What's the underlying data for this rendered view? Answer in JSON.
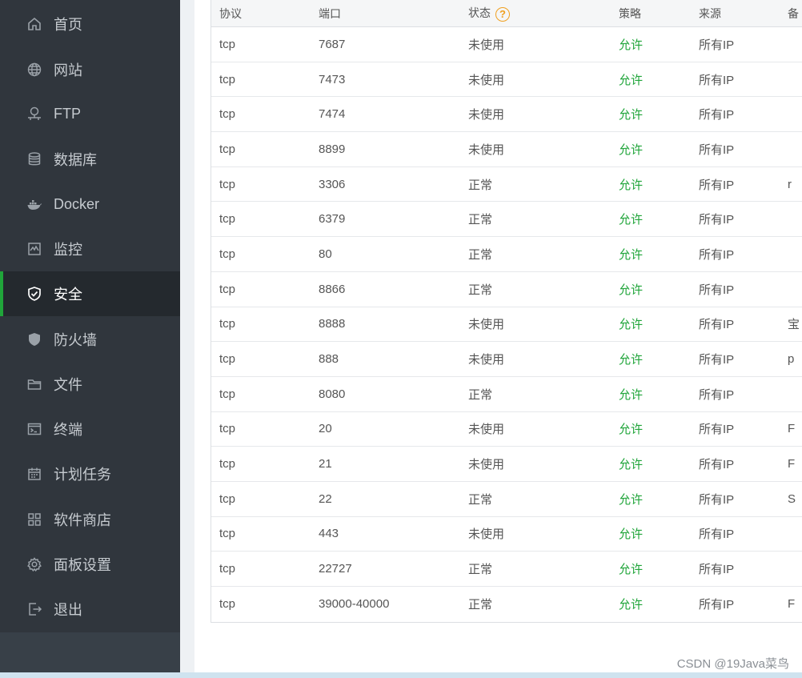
{
  "sidebar": {
    "items": [
      {
        "label": "首页",
        "icon": "home-icon"
      },
      {
        "label": "网站",
        "icon": "globe-icon"
      },
      {
        "label": "FTP",
        "icon": "ftp-icon"
      },
      {
        "label": "数据库",
        "icon": "database-icon"
      },
      {
        "label": "Docker",
        "icon": "docker-icon"
      },
      {
        "label": "监控",
        "icon": "monitor-icon"
      },
      {
        "label": "安全",
        "icon": "shield-check-icon",
        "active": true
      },
      {
        "label": "防火墙",
        "icon": "firewall-icon"
      },
      {
        "label": "文件",
        "icon": "folder-icon"
      },
      {
        "label": "终端",
        "icon": "terminal-icon"
      },
      {
        "label": "计划任务",
        "icon": "calendar-icon"
      },
      {
        "label": "软件商店",
        "icon": "grid-icon"
      },
      {
        "label": "面板设置",
        "icon": "gear-icon"
      },
      {
        "label": "退出",
        "icon": "logout-icon"
      }
    ]
  },
  "table": {
    "headers": [
      "协议",
      "端口",
      "状态",
      "策略",
      "来源",
      "备"
    ],
    "help_glyph": "?",
    "rows": [
      {
        "protocol": "tcp",
        "port": "7687",
        "status": "未使用",
        "policy": "允许",
        "source": "所有IP",
        "note": ""
      },
      {
        "protocol": "tcp",
        "port": "7473",
        "status": "未使用",
        "policy": "允许",
        "source": "所有IP",
        "note": ""
      },
      {
        "protocol": "tcp",
        "port": "7474",
        "status": "未使用",
        "policy": "允许",
        "source": "所有IP",
        "note": ""
      },
      {
        "protocol": "tcp",
        "port": "8899",
        "status": "未使用",
        "policy": "允许",
        "source": "所有IP",
        "note": ""
      },
      {
        "protocol": "tcp",
        "port": "3306",
        "status": "正常",
        "policy": "允许",
        "source": "所有IP",
        "note": "r"
      },
      {
        "protocol": "tcp",
        "port": "6379",
        "status": "正常",
        "policy": "允许",
        "source": "所有IP",
        "note": ""
      },
      {
        "protocol": "tcp",
        "port": "80",
        "status": "正常",
        "policy": "允许",
        "source": "所有IP",
        "note": ""
      },
      {
        "protocol": "tcp",
        "port": "8866",
        "status": "正常",
        "policy": "允许",
        "source": "所有IP",
        "note": ""
      },
      {
        "protocol": "tcp",
        "port": "8888",
        "status": "未使用",
        "policy": "允许",
        "source": "所有IP",
        "note": "宝"
      },
      {
        "protocol": "tcp",
        "port": "888",
        "status": "未使用",
        "policy": "允许",
        "source": "所有IP",
        "note": "p"
      },
      {
        "protocol": "tcp",
        "port": "8080",
        "status": "正常",
        "policy": "允许",
        "source": "所有IP",
        "note": ""
      },
      {
        "protocol": "tcp",
        "port": "20",
        "status": "未使用",
        "policy": "允许",
        "source": "所有IP",
        "note": "F"
      },
      {
        "protocol": "tcp",
        "port": "21",
        "status": "未使用",
        "policy": "允许",
        "source": "所有IP",
        "note": "F"
      },
      {
        "protocol": "tcp",
        "port": "22",
        "status": "正常",
        "policy": "允许",
        "source": "所有IP",
        "note": "S"
      },
      {
        "protocol": "tcp",
        "port": "443",
        "status": "未使用",
        "policy": "允许",
        "source": "所有IP",
        "note": ""
      },
      {
        "protocol": "tcp",
        "port": "22727",
        "status": "正常",
        "policy": "允许",
        "source": "所有IP",
        "note": ""
      },
      {
        "protocol": "tcp",
        "port": "39000-40000",
        "status": "正常",
        "policy": "允许",
        "source": "所有IP",
        "note": "F"
      }
    ]
  },
  "watermark": "CSDN @19Java菜鸟",
  "colors": {
    "accent": "#20a53a",
    "sidebar": "#30363d",
    "warning": "#f0a020"
  }
}
